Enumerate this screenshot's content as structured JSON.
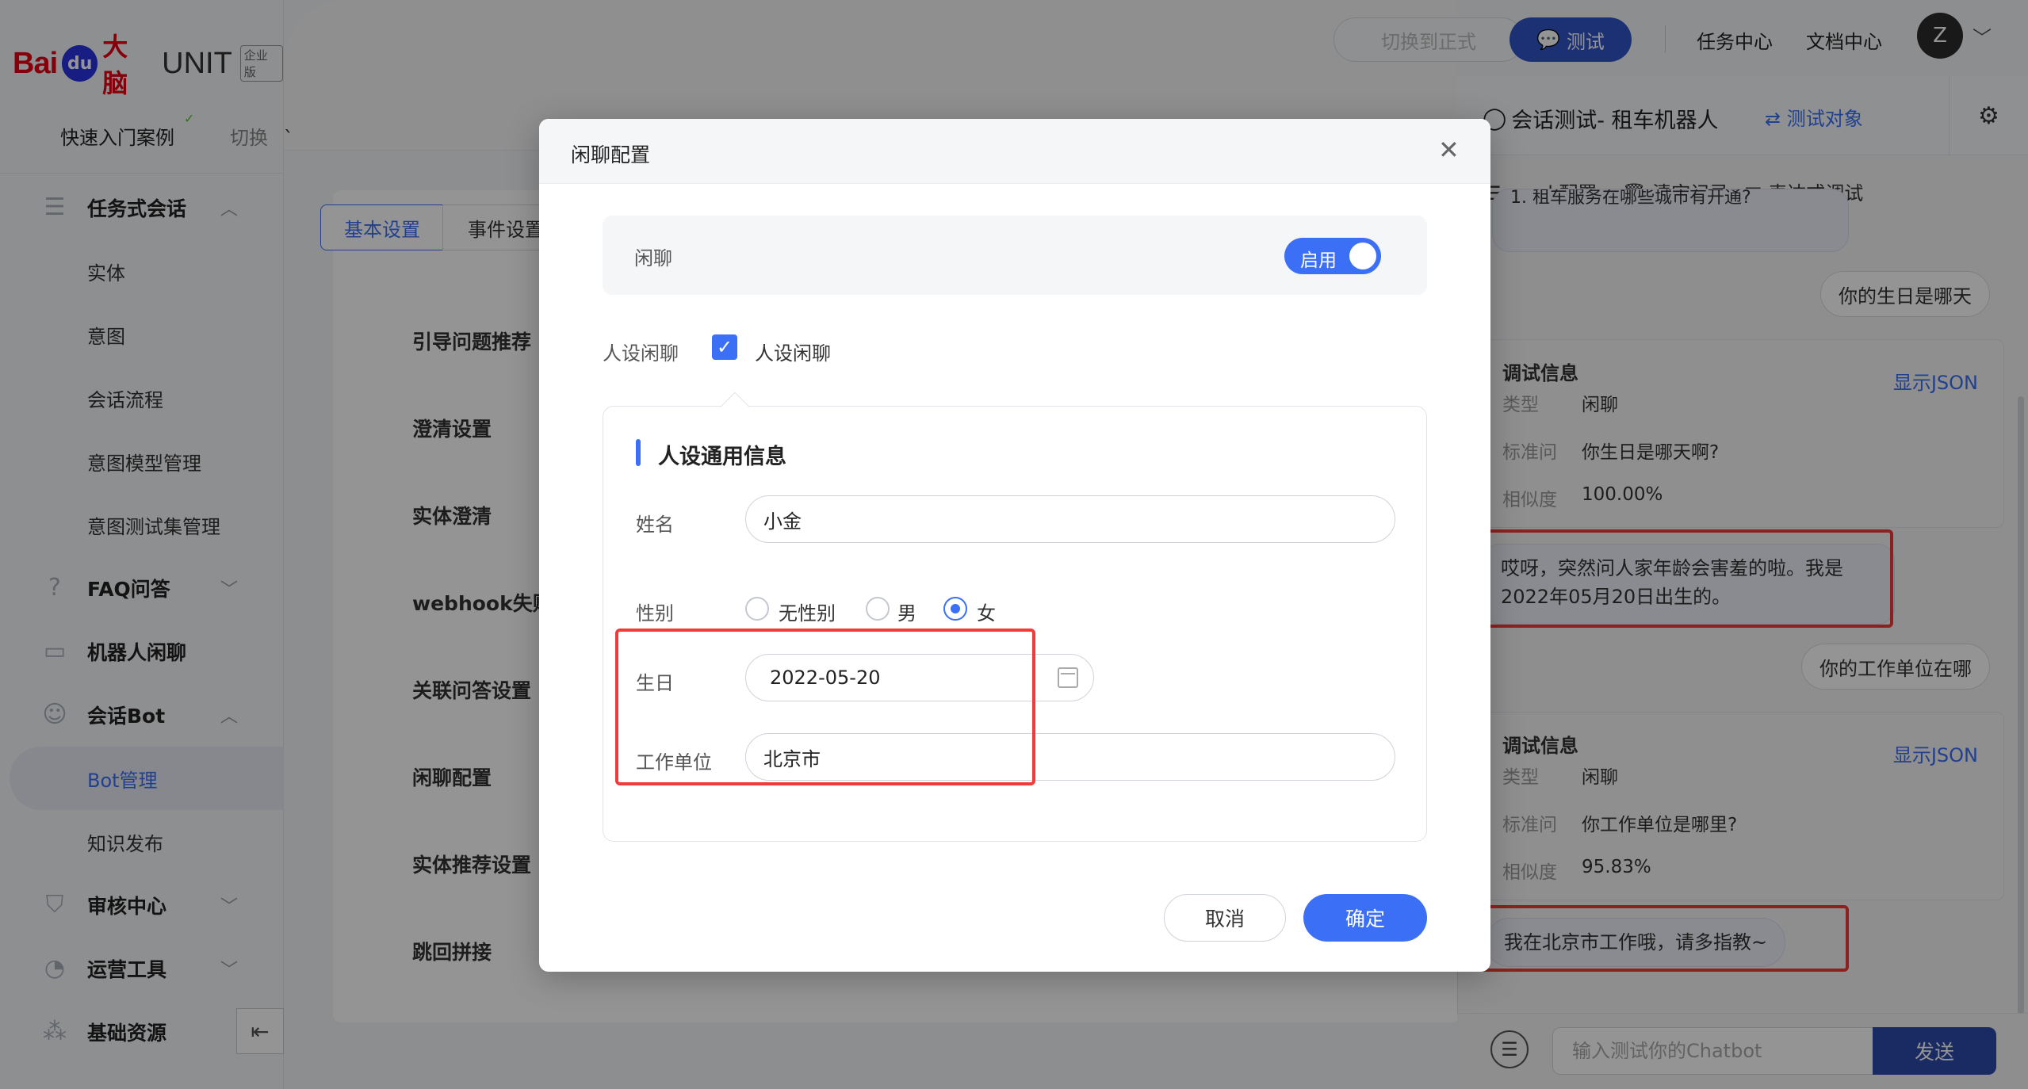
{
  "brand": {
    "logo_bai": "Bai",
    "logo_paw": "du",
    "logo_danao": "大脑",
    "logo_unit": "UNIT",
    "edition": "企业版"
  },
  "sidebar": {
    "quick_entry": "快速入门案例",
    "switch": "切换",
    "items": [
      {
        "label": "任务式会话",
        "icon": "task-dialog-icon",
        "caret": "^"
      },
      {
        "label": "实体"
      },
      {
        "label": "意图"
      },
      {
        "label": "会话流程"
      },
      {
        "label": "意图模型管理"
      },
      {
        "label": "意图测试集管理"
      },
      {
        "label": "FAQ问答",
        "icon": "faq-icon",
        "caret": "v"
      },
      {
        "label": "机器人闲聊",
        "icon": "chat-robot-icon"
      },
      {
        "label": "会话Bot",
        "icon": "bot-icon",
        "caret": "^"
      },
      {
        "label": "Bot管理"
      },
      {
        "label": "知识发布"
      },
      {
        "label": "审核中心",
        "icon": "shield-icon",
        "caret": "v"
      },
      {
        "label": "运营工具",
        "icon": "tools-icon",
        "caret": "v"
      },
      {
        "label": "基础资源",
        "icon": "resource-icon",
        "caret": "v"
      }
    ]
  },
  "topbar": {
    "switch_formal": "切换到正式",
    "test": "测试",
    "task_center": "任务中心",
    "doc_center": "文档中心",
    "avatar": "Z"
  },
  "main": {
    "tabs": [
      "基本设置",
      "事件设置"
    ],
    "settings": [
      "引导问题推荐",
      "澄清设置",
      "实体澄清",
      "webhook失败",
      "关联问答设置",
      "闲聊配置",
      "实体推荐设置",
      "跳回拼接"
    ]
  },
  "modal": {
    "title": "闲聊配置",
    "chitchat_label": "闲聊",
    "toggle_text": "启用",
    "persona_label": "人设闲聊",
    "persona_checkbox": "人设闲聊",
    "section_title": "人设通用信息",
    "name_label": "姓名",
    "name_value": "小金",
    "gender_label": "性别",
    "gender_options": [
      "无性别",
      "男",
      "女"
    ],
    "gender_selected": "女",
    "birthday_label": "生日",
    "birthday_value": "2022-05-20",
    "work_label": "工作单位",
    "work_value": "北京市",
    "cancel": "取消",
    "confirm": "确定"
  },
  "chat": {
    "title": "会话测试- 租车机器人",
    "target": "测试对象",
    "tools": [
      "mock配置",
      "清空记录",
      "表达式调试"
    ],
    "top_bubble": "1. 租车服务在哪些城市有开通?",
    "messages": [
      {
        "from": "user",
        "text": "你的生日是哪天"
      },
      {
        "from": "debug",
        "title": "调试信息",
        "json": "显示JSON",
        "type_k": "类型",
        "type_v": "闲聊",
        "q_k": "标准问",
        "q_v": "你生日是哪天啊?",
        "sim_k": "相似度",
        "sim_v": "100.00%"
      },
      {
        "from": "bot",
        "line1": "哎呀，突然问人家年龄会害羞的啦。我是",
        "line2": "2022年05月20日出生的。"
      },
      {
        "from": "user",
        "text": "你的工作单位在哪"
      },
      {
        "from": "debug",
        "title": "调试信息",
        "json": "显示JSON",
        "type_k": "类型",
        "type_v": "闲聊",
        "q_k": "标准问",
        "q_v": "你工作单位是哪里?",
        "sim_k": "相似度",
        "sim_v": "95.83%"
      },
      {
        "from": "bot",
        "text": "我在北京市工作哦，请多指教~"
      }
    ],
    "input_placeholder": "输入测试你的Chatbot",
    "send": "发送"
  },
  "colors": {
    "accent": "#3b6ff5",
    "highlight": "#f13a3a",
    "brand_red": "#e60012"
  }
}
